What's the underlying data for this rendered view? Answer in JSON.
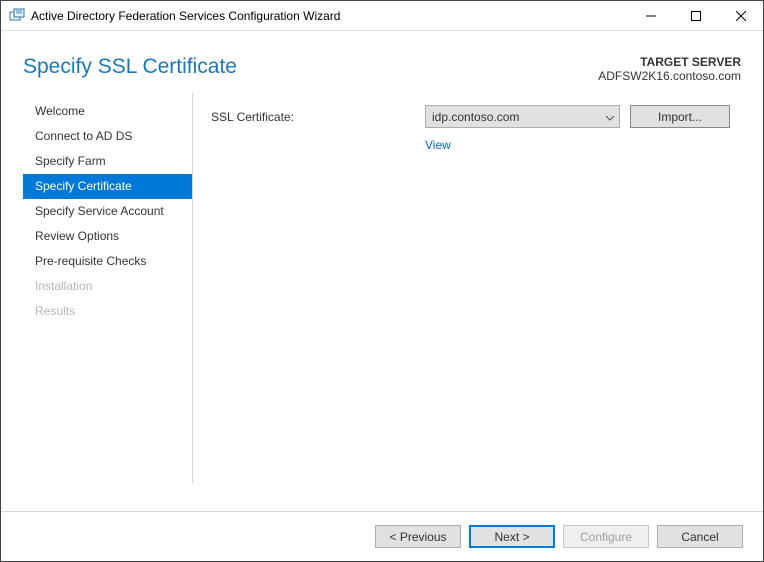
{
  "window": {
    "title": "Active Directory Federation Services Configuration Wizard"
  },
  "header": {
    "page_title": "Specify SSL Certificate",
    "target_label": "TARGET SERVER",
    "target_value": "ADFSW2K16.contoso.com"
  },
  "sidebar": {
    "items": [
      {
        "label": "Welcome",
        "state": "normal"
      },
      {
        "label": "Connect to AD DS",
        "state": "normal"
      },
      {
        "label": "Specify Farm",
        "state": "normal"
      },
      {
        "label": "Specify Certificate",
        "state": "active"
      },
      {
        "label": "Specify Service Account",
        "state": "normal"
      },
      {
        "label": "Review Options",
        "state": "normal"
      },
      {
        "label": "Pre-requisite Checks",
        "state": "normal"
      },
      {
        "label": "Installation",
        "state": "disabled"
      },
      {
        "label": "Results",
        "state": "disabled"
      }
    ]
  },
  "content": {
    "ssl_label": "SSL Certificate:",
    "ssl_selected": "idp.contoso.com",
    "import_label": "Import...",
    "view_label": "View"
  },
  "buttons": {
    "previous": "< Previous",
    "next": "Next >",
    "configure": "Configure",
    "cancel": "Cancel"
  }
}
